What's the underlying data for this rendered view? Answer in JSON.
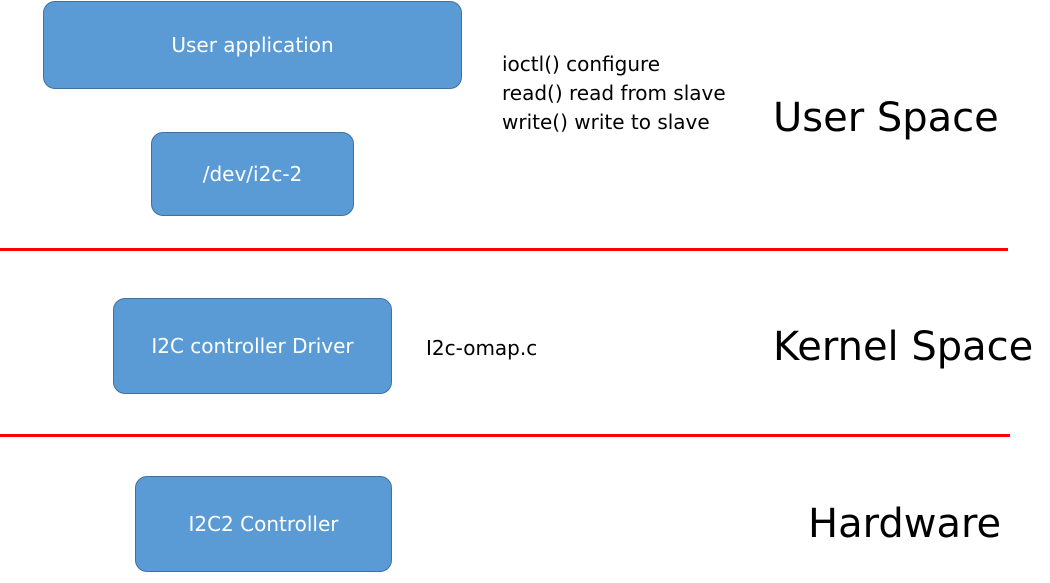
{
  "boxes": {
    "user_application": "User application",
    "dev_node": "/dev/i2c-2",
    "controller_driver": "I2C controller Driver",
    "hardware_controller": "I2C2 Controller"
  },
  "annotations": {
    "syscalls": [
      "ioctl() configure",
      "read() read from slave",
      "write() write to slave"
    ],
    "driver_file": "I2c-omap.c"
  },
  "zones": {
    "user_space": "User Space",
    "kernel_space": "Kernel Space",
    "hardware": "Hardware"
  },
  "colors": {
    "box_fill": "#5b9bd5",
    "box_border": "#41719c",
    "separator": "#ff0000"
  }
}
